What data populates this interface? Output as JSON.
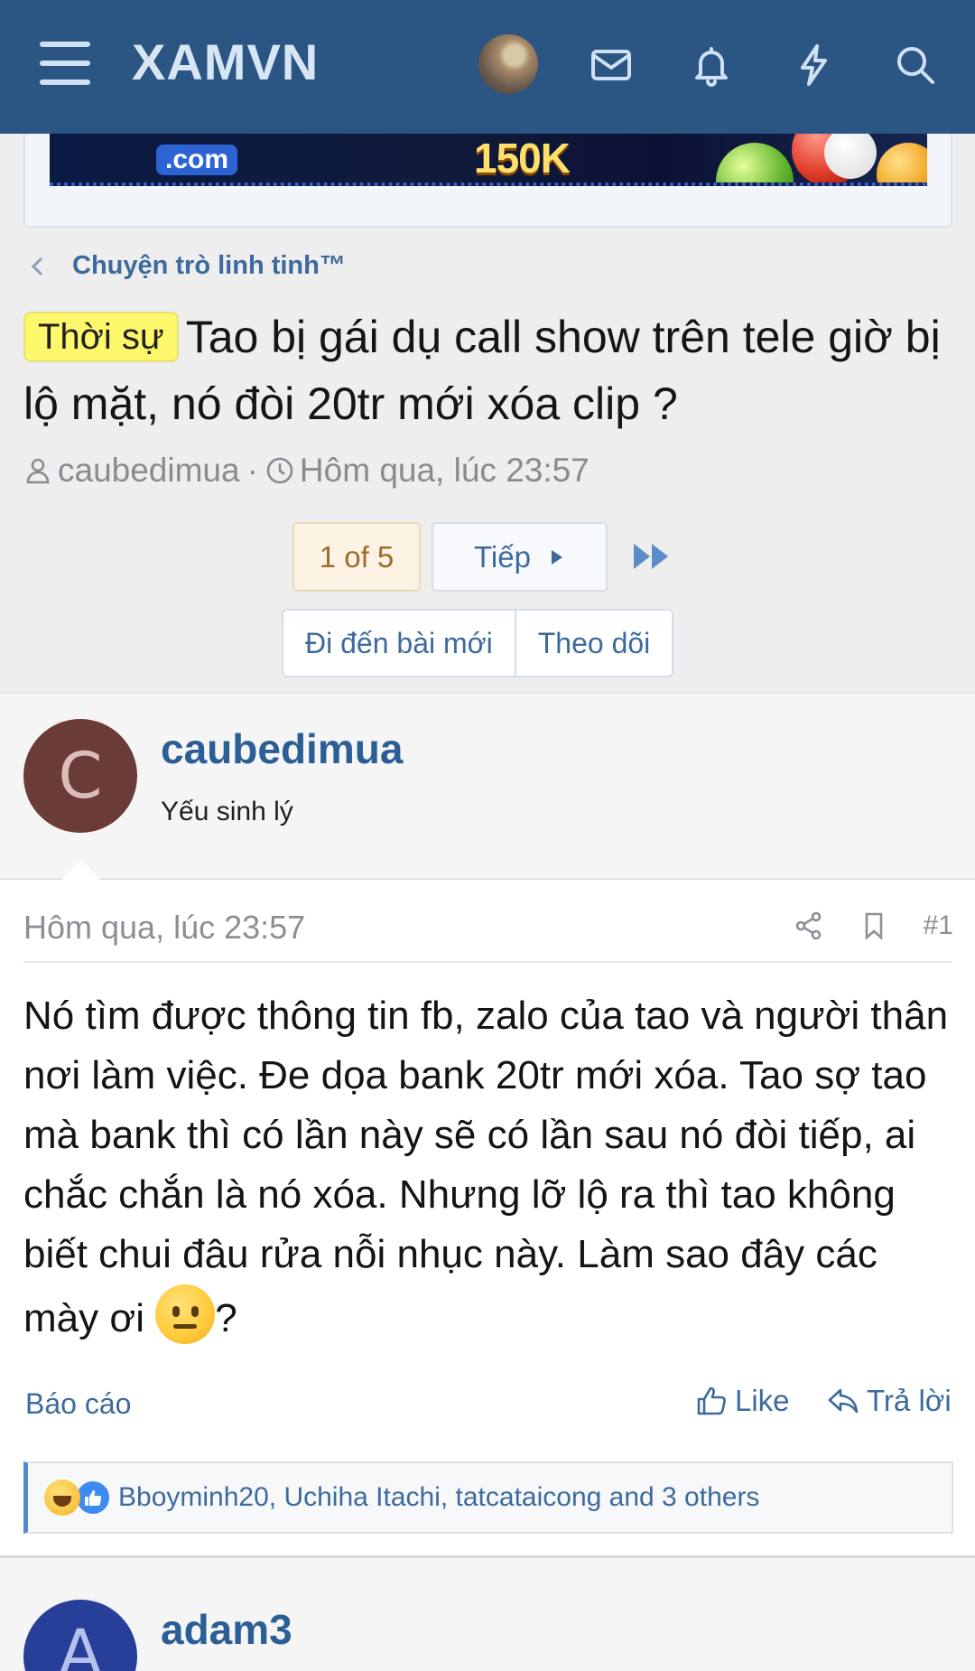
{
  "header": {
    "logo": "XAMVN",
    "icons": [
      "menu-icon",
      "envelope-icon",
      "bell-icon",
      "lightning-icon",
      "search-icon"
    ]
  },
  "banner": {
    "dotcom": ".com",
    "amount": "150K"
  },
  "breadcrumb": {
    "label": "Chuyện trò linh tinh™"
  },
  "thread": {
    "tag": "Thời sự",
    "title": "Tao bị gái dụ call show trên tele giờ bị lộ mặt, nó đòi 20tr mới xóa clip ?",
    "author": "caubedimua",
    "separator": "·",
    "date": "Hôm qua, lúc 23:57"
  },
  "pagination": {
    "current": "1 of 5",
    "next_label": "Tiếp"
  },
  "actions": {
    "goto_new": "Đi đến bài mới",
    "follow": "Theo dõi"
  },
  "post": {
    "avatar_letter": "C",
    "username": "caubedimua",
    "user_title": "Yếu sinh lý",
    "date": "Hôm qua, lúc 23:57",
    "number": "#1",
    "body_line1": "Nó tìm được thông tin fb, zalo của tao và người thân nơi làm việc. Đe dọa bank 20tr mới xóa. Tao sợ tao mà bank thì có lần này sẽ có lần sau nó đòi tiếp, ai chắc chắn là nó xóa. Nhưng lỡ lộ ra thì tao không biết chui đâu rửa nỗi nhục này. Làm sao đây các mày ơi ",
    "body_end": "?",
    "report": "Báo cáo",
    "like": "Like",
    "reply": "Trả lời",
    "reactions_text": "Bboyminh20, Uchiha Itachi, tatcataicong and 3 others"
  },
  "next_post": {
    "avatar_letter": "A",
    "username": "adam3"
  },
  "colors": {
    "header_bg": "#2b5582",
    "link": "#3d6a9d",
    "username": "#2c5e96",
    "tag_bg": "#fdf76b"
  }
}
